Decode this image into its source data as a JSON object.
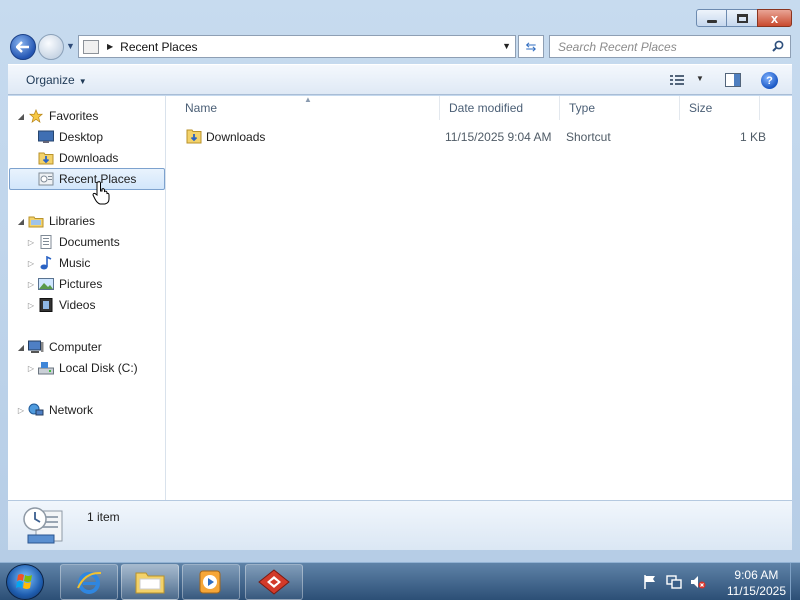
{
  "window": {
    "minimize_label": "",
    "maximize_label": "",
    "close_label": "x"
  },
  "address": {
    "path": "Recent Places",
    "search_placeholder": "Search Recent Places"
  },
  "toolbar": {
    "organize_label": "Organize",
    "help_label": "?"
  },
  "nav": {
    "favorites": "Favorites",
    "desktop": "Desktop",
    "downloads": "Downloads",
    "recent_places": "Recent Places",
    "libraries": "Libraries",
    "documents": "Documents",
    "music": "Music",
    "pictures": "Pictures",
    "videos": "Videos",
    "computer": "Computer",
    "local_disk": "Local Disk (C:)",
    "network": "Network"
  },
  "columns": {
    "name": "Name",
    "date_modified": "Date modified",
    "type": "Type",
    "size": "Size"
  },
  "files": [
    {
      "name": "Downloads",
      "date_modified": "11/15/2025 9:04 AM",
      "type": "Shortcut",
      "size": "1 KB"
    }
  ],
  "details": {
    "item_count": "1 item"
  },
  "taskbar": {
    "time": "9:06 AM",
    "date": "11/15/2025"
  },
  "colors": {
    "selection_bg": "#d2e6fb",
    "selection_border": "#7da2ce",
    "taskbar": "#2c4f76"
  }
}
